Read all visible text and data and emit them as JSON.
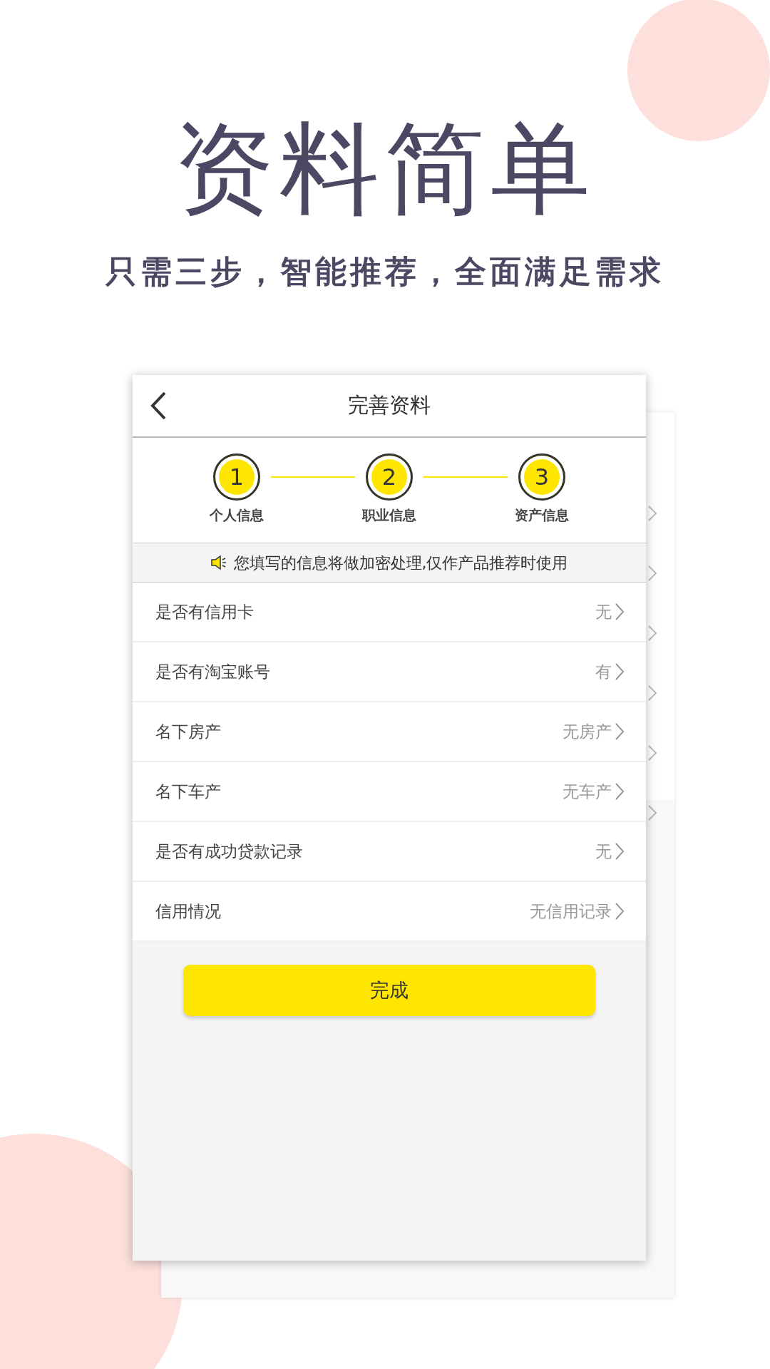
{
  "headline": "资料简单",
  "subheadline": "只需三步，智能推荐，全面满足需求",
  "screen": {
    "title": "完善资料",
    "steps": [
      {
        "number": "1",
        "label": "个人信息"
      },
      {
        "number": "2",
        "label": "职业信息"
      },
      {
        "number": "3",
        "label": "资产信息"
      }
    ],
    "notice": "您填写的信息将做加密处理,仅作产品推荐时使用",
    "fields": [
      {
        "label": "是否有信用卡",
        "value": "无"
      },
      {
        "label": "是否有淘宝账号",
        "value": "有"
      },
      {
        "label": "名下房产",
        "value": "无房产"
      },
      {
        "label": "名下车产",
        "value": "无车产"
      },
      {
        "label": "是否有成功贷款记录",
        "value": "无"
      },
      {
        "label": "信用情况",
        "value": "无信用记录"
      }
    ],
    "submit_button": "完成"
  }
}
